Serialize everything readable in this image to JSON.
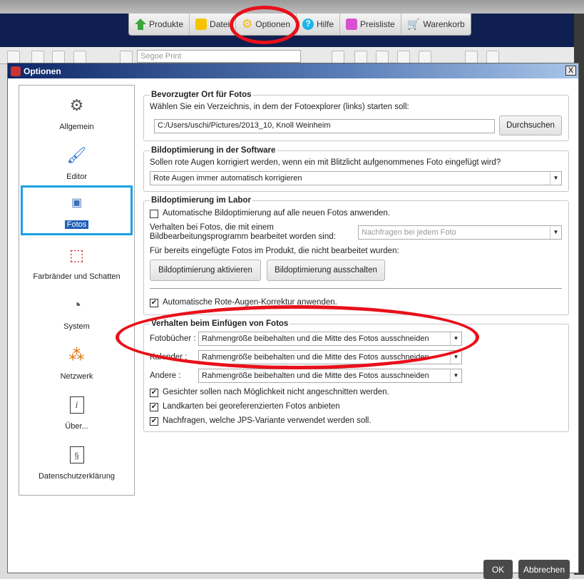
{
  "menu": {
    "tabs": [
      {
        "label": "Produkte",
        "icon": "home-icon",
        "color": "#3aa63a"
      },
      {
        "label": "Datei",
        "icon": "folder-icon",
        "color": "#f5c400"
      },
      {
        "label": "Optionen",
        "icon": "gear-icon",
        "color": "#f5b800"
      },
      {
        "label": "Hilfe",
        "icon": "help-icon",
        "color": "#1eb4e8"
      },
      {
        "label": "Preisliste",
        "icon": "pricelist-icon",
        "color": "#d94fd2"
      },
      {
        "label": "Warenkorb",
        "icon": "cart-icon",
        "color": "#e84a4a"
      }
    ]
  },
  "toolbar": {
    "font_select": "Segoe Print"
  },
  "dialog": {
    "title": "Optionen",
    "close": "X",
    "sidebar": [
      {
        "label": "Allgemein",
        "icon": "gear-icon"
      },
      {
        "label": "Editor",
        "icon": "brush-icon"
      },
      {
        "label": "Fotos",
        "icon": "photo-icon",
        "active": true
      },
      {
        "label": "Farbränder und Schatten",
        "icon": "border-shadow-icon"
      },
      {
        "label": "System",
        "icon": "system-icon"
      },
      {
        "label": "Netzwerk",
        "icon": "network-icon"
      },
      {
        "label": "Über...",
        "icon": "info-icon"
      },
      {
        "label": "Datenschutzerklärung",
        "icon": "privacy-icon"
      }
    ],
    "loc": {
      "title": "Bevorzugter Ort für Fotos",
      "desc": "Wählen Sie ein Verzeichnis, in dem der Fotoexplorer (links) starten soll:",
      "path": "C:/Users/uschi/Pictures/2013_10, Knoll Weinheim",
      "browse": "Durchsuchen"
    },
    "soft": {
      "title": "Bildoptimierung in der Software",
      "desc": "Sollen rote Augen korrigiert werden, wenn ein mit Blitzlicht aufgenommenes Foto eingefügt wird?",
      "select": "Rote Augen immer automatisch korrigieren"
    },
    "lab": {
      "title": "Bildoptimierung im Labor",
      "auto": "Automatische Bildoptimierung auf alle neuen Fotos anwenden.",
      "auto_checked": false,
      "behav1": "Verhalten bei Fotos, die mit einem",
      "behav2": "Bildbearbeitungsprogramm bearbeitet worden sind:",
      "behav_select": "Nachfragen bei jedem Foto",
      "existing": "Für bereits eingefügte Fotos im Produkt, die nicht bearbeitet wurden:",
      "activate": "Bildoptimierung aktivieren",
      "deactivate": "Bildoptimierung ausschalten",
      "redeye": "Automatische Rote-Augen-Korrektur anwenden.",
      "redeye_checked": true
    },
    "insert": {
      "title": "Verhalten beim Einfügen von Fotos",
      "rows": [
        {
          "label": "Fotobücher :",
          "value": "Rahmengröße beibehalten und die Mitte des Fotos ausschneiden"
        },
        {
          "label": "Kalender :",
          "value": "Rahmengröße beibehalten und die Mitte des Fotos ausschneiden"
        },
        {
          "label": "Andere :",
          "value": "Rahmengröße beibehalten und die Mitte des Fotos ausschneiden"
        }
      ],
      "checks": [
        {
          "label": "Gesichter sollen nach Möglichkeit nicht angeschnitten werden.",
          "checked": true
        },
        {
          "label": "Landkarten bei georeferenzierten Fotos anbieten",
          "checked": true
        },
        {
          "label": "Nachfragen, welche JPS-Variante verwendet werden soll.",
          "checked": true
        }
      ]
    },
    "ok": "OK",
    "cancel": "Abbrechen"
  },
  "annotation_color": "#e8101a"
}
